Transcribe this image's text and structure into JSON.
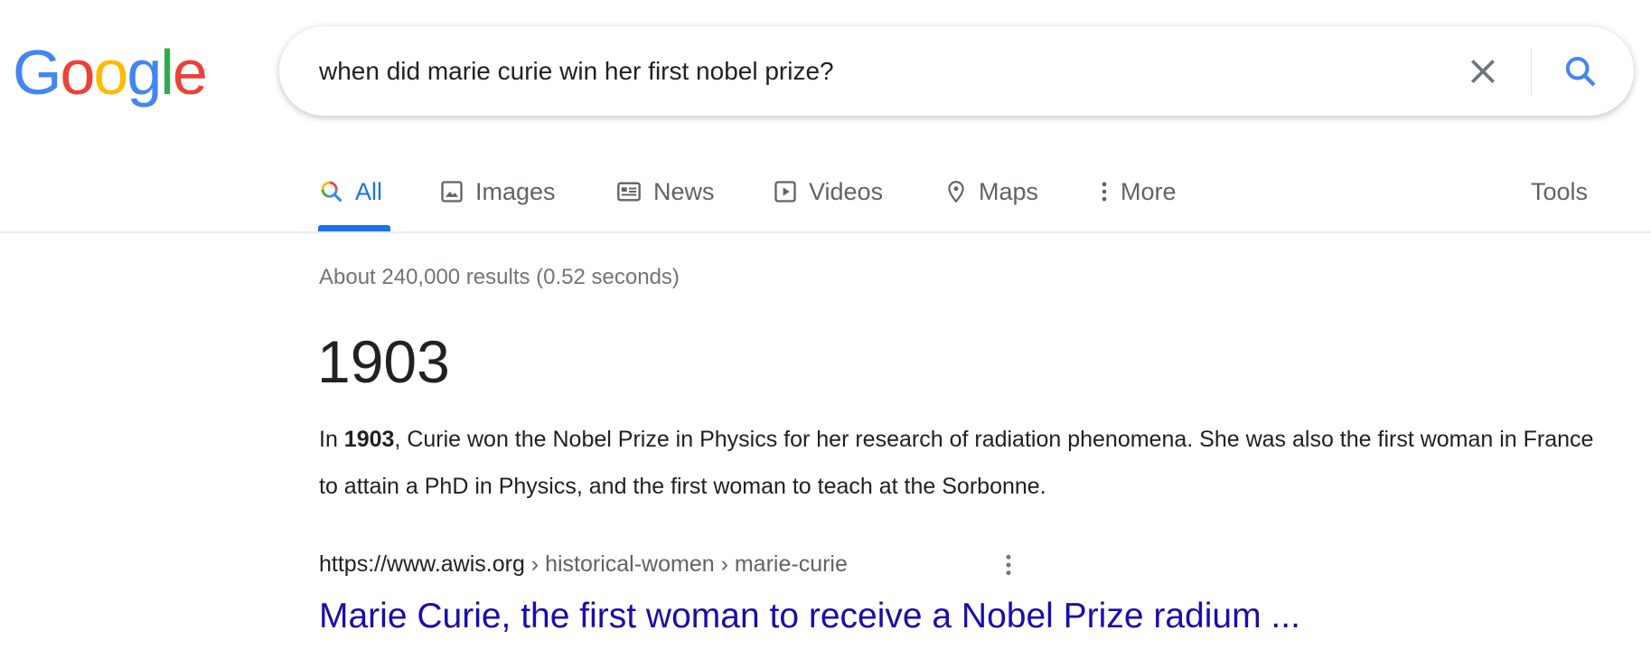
{
  "logo": {
    "letters": [
      "G",
      "o",
      "o",
      "g",
      "l",
      "e"
    ],
    "colors": [
      "#4285f4",
      "#ea4335",
      "#fbbc05",
      "#4285f4",
      "#34a853",
      "#ea4335"
    ]
  },
  "search": {
    "query": "when did marie curie win her first nobel prize?",
    "clear_icon": "close-icon",
    "search_icon": "search-icon"
  },
  "tabs": [
    {
      "label": "All",
      "icon": "search-multicolor-icon",
      "active": true
    },
    {
      "label": "Images",
      "icon": "image-icon"
    },
    {
      "label": "News",
      "icon": "newspaper-icon"
    },
    {
      "label": "Videos",
      "icon": "play-icon"
    },
    {
      "label": "Maps",
      "icon": "map-pin-icon"
    },
    {
      "label": "More",
      "icon": "more-vert-icon"
    }
  ],
  "tools_label": "Tools",
  "stats": "About 240,000 results (0.52 seconds)",
  "answer": {
    "value": "1903",
    "snippet_prefix": "In ",
    "snippet_bold": "1903",
    "snippet_rest": ", Curie won the Nobel Prize in Physics for her research of radiation phenomena. She was also the first woman in France to attain a PhD in Physics, and the first woman to teach at the Sorbonne."
  },
  "result": {
    "domain": "https://www.awis.org",
    "path": " › historical-women › marie-curie",
    "title": "Marie Curie, the first woman to receive a Nobel Prize radium ..."
  },
  "colors": {
    "accent": "#1a73e8",
    "link": "#1a0dab"
  }
}
